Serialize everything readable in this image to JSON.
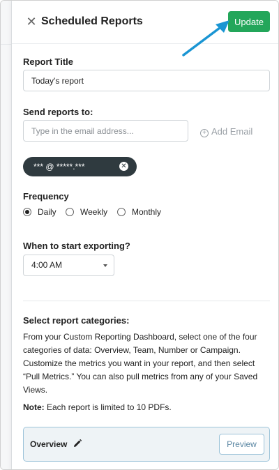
{
  "header": {
    "title": "Scheduled Reports",
    "close_icon": "close-icon",
    "update_label": "Update"
  },
  "report_title": {
    "label": "Report Title",
    "value": "Today's report"
  },
  "send_to": {
    "label": "Send reports to:",
    "placeholder": "Type in the email address...",
    "add_email_label": "Add Email",
    "chips": [
      "*** @ *****.***"
    ]
  },
  "frequency": {
    "label": "Frequency",
    "options": [
      "Daily",
      "Weekly",
      "Monthly"
    ],
    "selected": "Daily"
  },
  "start_exporting": {
    "label": "When to start exporting?",
    "value": "4:00 AM"
  },
  "categories": {
    "label": "Select report categories:",
    "description": "From your Custom Reporting Dashboard, select one of the four categories of data: Overview, Team, Number or Campaign. Customize the metrics you want in your report, and then select “Pull Metrics.” You can also pull metrics from any of your Saved Views.",
    "note_label": "Note:",
    "note_text": " Each report is limited to 10 PDFs."
  },
  "card": {
    "title": "Overview",
    "preview_label": "Preview"
  },
  "colors": {
    "accent_green": "#23a65a",
    "annotation_arrow": "#1a95d3",
    "chip_bg": "#2f3a3f"
  }
}
